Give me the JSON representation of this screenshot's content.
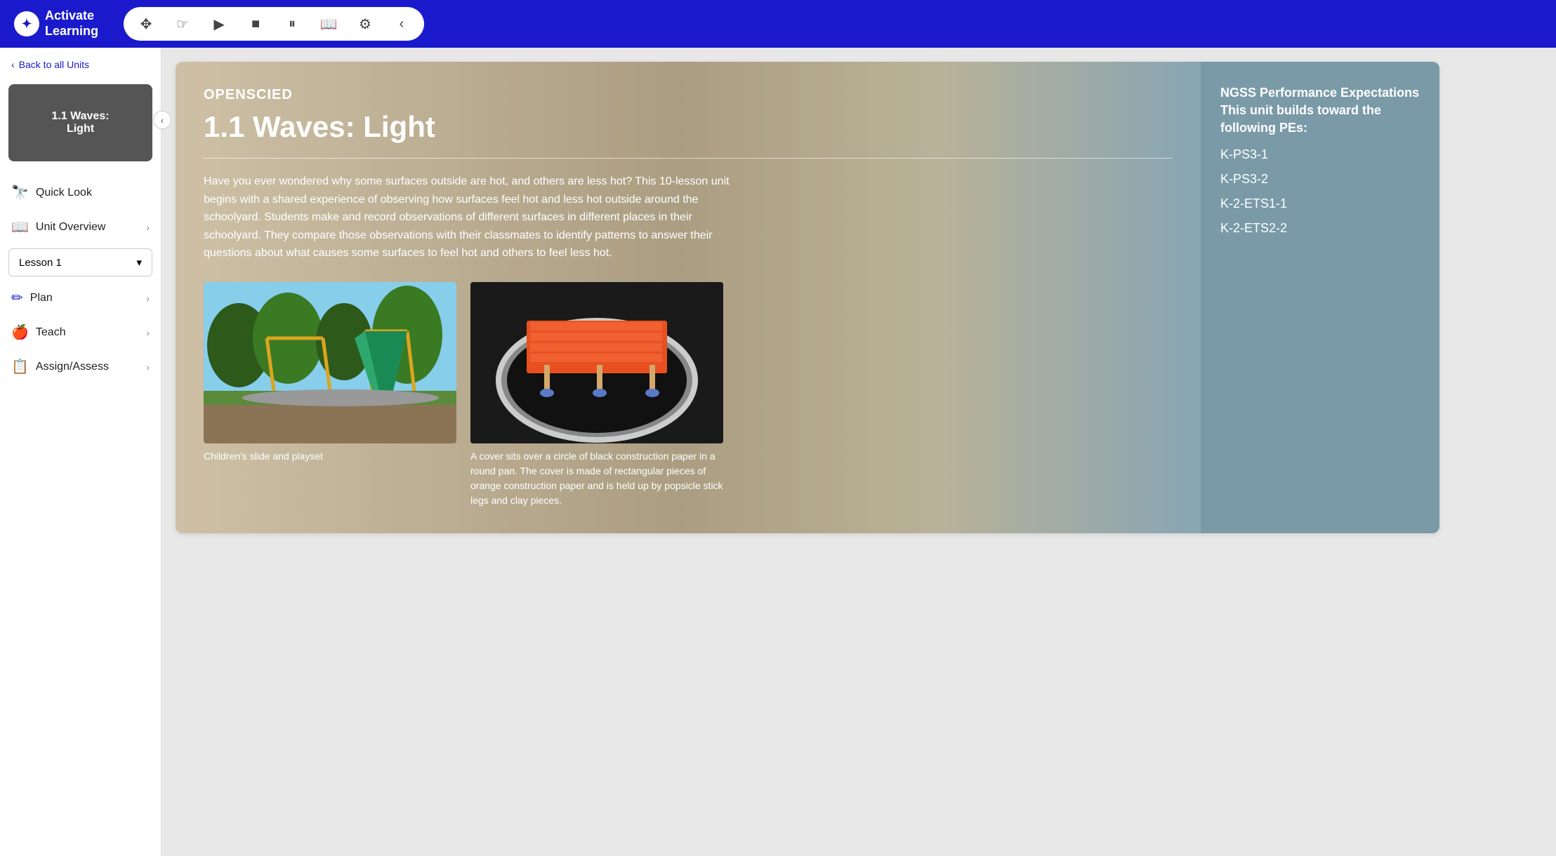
{
  "app": {
    "name": "Activate",
    "name2": "Learning"
  },
  "toolbar": {
    "buttons": [
      {
        "name": "move-tool",
        "icon": "✥",
        "label": "Move"
      },
      {
        "name": "hand-tool",
        "icon": "✋",
        "label": "Hand"
      },
      {
        "name": "play-button",
        "icon": "▶",
        "label": "Play"
      },
      {
        "name": "stop-button",
        "icon": "■",
        "label": "Stop"
      },
      {
        "name": "pause-button",
        "icon": "⏸",
        "label": "Pause"
      },
      {
        "name": "book-button",
        "icon": "📖",
        "label": "Book"
      },
      {
        "name": "settings-button",
        "icon": "⚙",
        "label": "Settings"
      },
      {
        "name": "collapse-toolbar",
        "icon": "‹",
        "label": "Collapse"
      }
    ]
  },
  "sidebar": {
    "back_link": "Back to all Units",
    "unit_card": {
      "title": "1.1 Waves:\nLight"
    },
    "nav_items": [
      {
        "id": "quick-look",
        "label": "Quick Look",
        "icon": "🔭",
        "has_chevron": false
      },
      {
        "id": "unit-overview",
        "label": "Unit Overview",
        "icon": "📖",
        "has_chevron": true
      },
      {
        "id": "lesson-selector",
        "label": "Lesson 1",
        "is_dropdown": true
      },
      {
        "id": "plan",
        "label": "Plan",
        "icon": "✏",
        "has_chevron": true
      },
      {
        "id": "teach",
        "label": "Teach",
        "icon": "🍎",
        "has_chevron": true
      },
      {
        "id": "assign-assess",
        "label": "Assign/Assess",
        "icon": "📋",
        "has_chevron": true
      }
    ]
  },
  "content": {
    "openscied_label": "OPENSCIED",
    "unit_title": "1.1 Waves: Light",
    "description": "Have you ever wondered why some surfaces outside are hot, and others are less hot? This 10-lesson unit begins with a shared experience of observing how surfaces feel hot and less hot outside around the schoolyard. Students make and record observations of different surfaces in different places in their schoolyard. They compare those observations with their classmates to identify patterns to answer their questions about what causes some surfaces to feel hot and others to feel less hot.",
    "image1": {
      "caption": "Children's slide and playset"
    },
    "image2": {
      "caption": "A cover sits over a circle of black construction paper in a round pan. The cover is made of rectangular pieces of orange construction paper and is held up by popsicle stick legs and clay pieces."
    },
    "ngss": {
      "title": "NGSS Performance Expectations",
      "subtitle": "This unit builds toward the following PEs:",
      "items": [
        "K-PS3-1",
        "K-PS3-2",
        "K-2-ETS1-1",
        "K-2-ETS2-2"
      ]
    }
  }
}
